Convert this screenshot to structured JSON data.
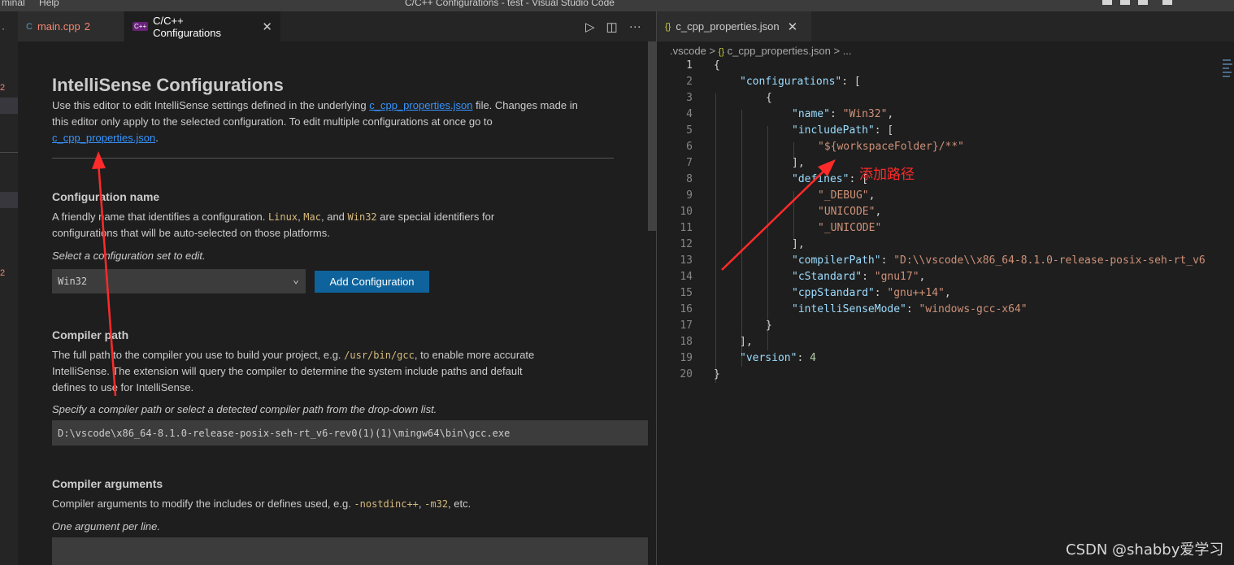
{
  "titlebar": {
    "menu": [
      "minal",
      "Help"
    ],
    "title": "C/C++ Configurations - test - Visual Studio Code"
  },
  "leftstrip": {
    "dot": "·",
    "badge1": "2",
    "badge2": "2"
  },
  "left_tabs": [
    {
      "label": "main.cpp",
      "badge": "2",
      "icon": "C"
    },
    {
      "label": "C/C++ Configurations",
      "close": "✕",
      "icon": "C++"
    }
  ],
  "left_actions": {
    "run": "▷",
    "split": "◫",
    "more": "···"
  },
  "right_tab": {
    "label": "c_cpp_properties.json",
    "close": "✕",
    "icon": "{}"
  },
  "settings": {
    "heading": "IntelliSense Configurations",
    "intro_a": "Use this editor to edit IntelliSense settings defined in the underlying ",
    "intro_link": "c_cpp_properties.json",
    "intro_b": " file. Changes made in",
    "intro_c": "this editor only apply to the selected configuration. To edit multiple configurations at once go to",
    "intro_link2": "c_cpp_properties.json",
    "intro_end": ".",
    "config_name_title": "Configuration name",
    "config_name_desc_a": "A friendly name that identifies a configuration. ",
    "linux": "Linux",
    "comma": ", ",
    "mac": "Mac",
    "and": ", and ",
    "win32_code": "Win32",
    "config_name_desc_b": " are special identifiers for",
    "config_name_desc_c": "configurations that will be auto-selected on those platforms.",
    "select_hint": "Select a configuration set to edit.",
    "select_value": "Win32",
    "select_chevron": "⌄",
    "add_button": "Add Configuration",
    "compiler_path_title": "Compiler path",
    "compiler_desc_a": "The full path to the compiler you use to build your project, e.g. ",
    "compiler_desc_code": "/usr/bin/gcc",
    "compiler_desc_b": ", to enable more accurate",
    "compiler_desc_c": "IntelliSense. The extension will query the compiler to determine the system include paths and default",
    "compiler_desc_d": "defines to use for IntelliSense.",
    "compiler_hint": "Specify a compiler path or select a detected compiler path from the drop-down list.",
    "compiler_value": "D:\\vscode\\x86_64-8.1.0-release-posix-seh-rt_v6-rev0(1)(1)\\mingw64\\bin\\gcc.exe",
    "compiler_args_title": "Compiler arguments",
    "compiler_args_desc_a": "Compiler arguments to modify the includes or defines used, e.g. ",
    "args_code1": "-nostdinc++",
    "args_sep": ", ",
    "args_code2": "-m32",
    "args_end": ", etc.",
    "args_hint": "One argument per line.",
    "args_value": ""
  },
  "breadcrumb": {
    "folder": ".vscode",
    "sep": ">",
    "icon": "{}",
    "file": "c_cpp_properties.json",
    "more": "..."
  },
  "code": {
    "line_numbers": [
      "1",
      "2",
      "3",
      "4",
      "5",
      "6",
      "7",
      "8",
      "9",
      "10",
      "11",
      "12",
      "13",
      "14",
      "15",
      "16",
      "17",
      "18",
      "19",
      "20"
    ],
    "l1": "{",
    "l2_key": "\"configurations\"",
    "l2_rest": ": [",
    "l3": "{",
    "l4_key": "\"name\"",
    "l4_colon": ": ",
    "l4_val": "\"Win32\"",
    "l4_end": ",",
    "l5_key": "\"includePath\"",
    "l5_rest": ": [",
    "l6_val": "\"${workspaceFolder}/**\"",
    "l7": "],",
    "l8_key": "\"defines\"",
    "l8_rest": ": [",
    "l9_val": "\"_DEBUG\"",
    "l9_end": ",",
    "l10_val": "\"UNICODE\"",
    "l10_end": ",",
    "l11_val": "\"_UNICODE\"",
    "l12": "],",
    "l13_key": "\"compilerPath\"",
    "l13_colon": ": ",
    "l13_val": "\"D:\\\\vscode\\\\x86_64-8.1.0-release-posix-seh-rt_v6",
    "l14_key": "\"cStandard\"",
    "l14_colon": ": ",
    "l14_val": "\"gnu17\"",
    "l14_end": ",",
    "l15_key": "\"cppStandard\"",
    "l15_colon": ": ",
    "l15_val": "\"gnu++14\"",
    "l15_end": ",",
    "l16_key": "\"intelliSenseMode\"",
    "l16_colon": ": ",
    "l16_val": "\"windows-gcc-x64\"",
    "l17": "}",
    "l18": "],",
    "l19_key": "\"version\"",
    "l19_colon": ": ",
    "l19_val": "4",
    "l20": "}"
  },
  "annotation": {
    "text": "添加路径"
  },
  "watermark": "CSDN @shabby爱学习",
  "colors": {
    "accent_button": "#0e639c",
    "link": "#3794ff",
    "annotation": "#ff2a2a",
    "json_key": "#9cdcfe",
    "json_string": "#ce9178",
    "json_number": "#b5cea8"
  }
}
